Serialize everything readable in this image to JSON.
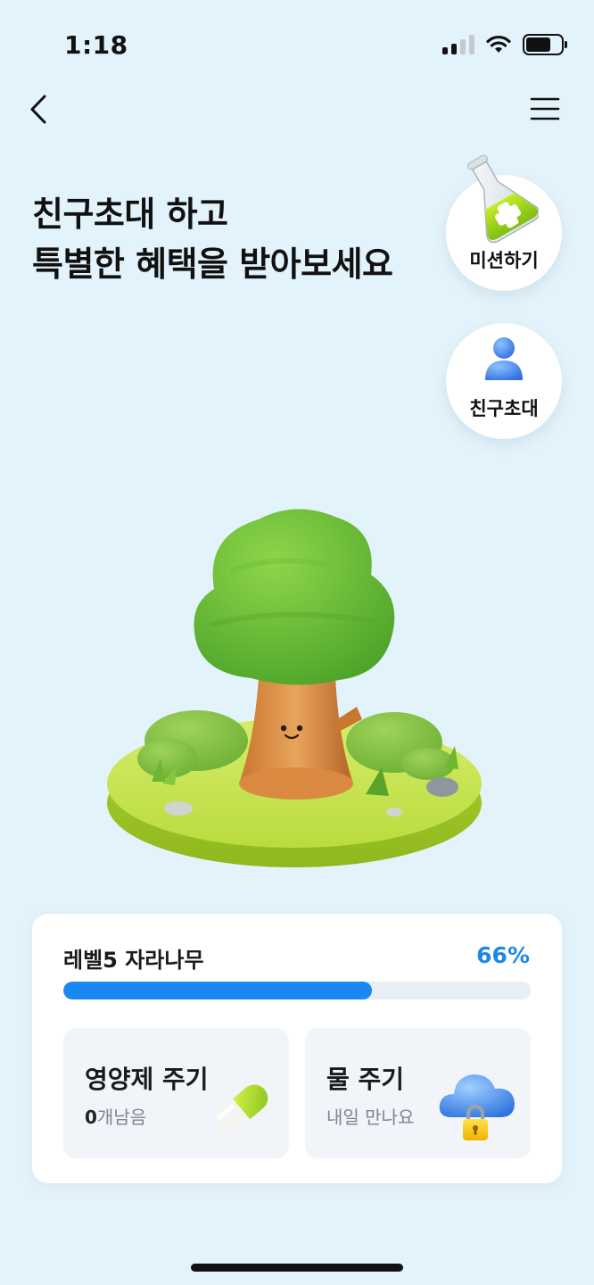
{
  "status_bar": {
    "time": "1:18",
    "signal_icon": "signal-icon",
    "wifi_icon": "wifi-icon",
    "battery_icon": "battery-icon",
    "battery_level": 0.7
  },
  "nav": {
    "back_icon": "chevron-left-icon",
    "menu_icon": "hamburger-menu-icon"
  },
  "headline": {
    "line1": "친구초대 하고",
    "line2": "특별한 혜택을 받아보세요"
  },
  "side_buttons": {
    "mission": {
      "label": "미션하기",
      "icon": "flask-icon"
    },
    "invite": {
      "label": "친구초대",
      "icon": "person-icon"
    }
  },
  "tree": {
    "icon": "tree-illustration"
  },
  "level_card": {
    "level_label": "레벨5 자라나무",
    "percent_label": "66%",
    "progress": 0.66,
    "progress_color": "#1a87f2",
    "nutrient": {
      "title": "영양제 주기",
      "count": "0",
      "count_suffix": "개남음",
      "icon": "pill-icon"
    },
    "water": {
      "title": "물 주기",
      "subtitle": "내일 만나요",
      "icon": "cloud-lock-icon"
    }
  }
}
